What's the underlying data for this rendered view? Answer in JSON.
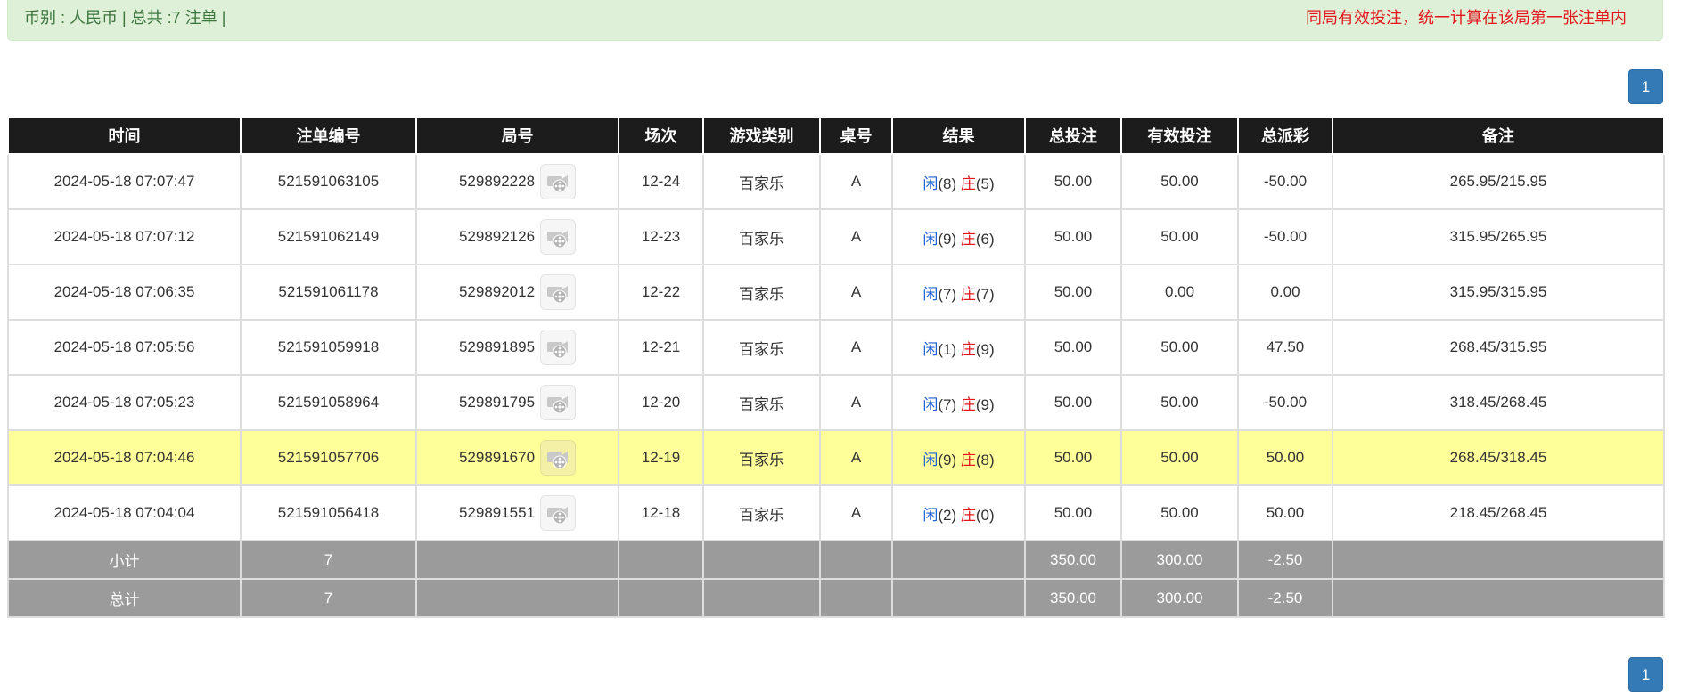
{
  "alert": {
    "currency_summary": "币别 : 人民币 | 总共 :7 注单 |",
    "notice": "同局有效投注，统一计算在该局第一张注单内"
  },
  "pagination": {
    "current_page": "1"
  },
  "colors": {
    "blue": "#1a62d6",
    "red": "#e4161c",
    "highlight": "#ffff99",
    "header": "#1c1c1c",
    "footer": "#9b9b9b"
  },
  "table": {
    "headers": [
      "时间",
      "注单编号",
      "局号",
      "场次",
      "游戏类别",
      "桌号",
      "结果",
      "总投注",
      "有效投注",
      "总派彩",
      "备注"
    ],
    "player_label": "闲",
    "banker_label": "庄",
    "icon": "video-replay-icon",
    "rows": [
      {
        "time": "2024-05-18 07:07:47",
        "bet_id": "521591063105",
        "round": "529892228",
        "session": "12-24",
        "game": "百家乐",
        "table_no": "A",
        "player_score": "(8)",
        "banker_score": "(5)",
        "total_bet": "50.00",
        "valid_bet": "50.00",
        "payout": "-50.00",
        "payout_negative": true,
        "note": "265.95/215.95",
        "highlight": false
      },
      {
        "time": "2024-05-18 07:07:12",
        "bet_id": "521591062149",
        "round": "529892126",
        "session": "12-23",
        "game": "百家乐",
        "table_no": "A",
        "player_score": "(9)",
        "banker_score": "(6)",
        "total_bet": "50.00",
        "valid_bet": "50.00",
        "payout": "-50.00",
        "payout_negative": true,
        "note": "315.95/265.95",
        "highlight": false
      },
      {
        "time": "2024-05-18 07:06:35",
        "bet_id": "521591061178",
        "round": "529892012",
        "session": "12-22",
        "game": "百家乐",
        "table_no": "A",
        "player_score": "(7)",
        "banker_score": "(7)",
        "total_bet": "50.00",
        "valid_bet": "0.00",
        "payout": "0.00",
        "payout_negative": false,
        "note": "315.95/315.95",
        "highlight": false
      },
      {
        "time": "2024-05-18 07:05:56",
        "bet_id": "521591059918",
        "round": "529891895",
        "session": "12-21",
        "game": "百家乐",
        "table_no": "A",
        "player_score": "(1)",
        "banker_score": "(9)",
        "total_bet": "50.00",
        "valid_bet": "50.00",
        "payout": "47.50",
        "payout_negative": false,
        "note": "268.45/315.95",
        "highlight": false
      },
      {
        "time": "2024-05-18 07:05:23",
        "bet_id": "521591058964",
        "round": "529891795",
        "session": "12-20",
        "game": "百家乐",
        "table_no": "A",
        "player_score": "(7)",
        "banker_score": "(9)",
        "total_bet": "50.00",
        "valid_bet": "50.00",
        "payout": "-50.00",
        "payout_negative": true,
        "note": "318.45/268.45",
        "highlight": false
      },
      {
        "time": "2024-05-18 07:04:46",
        "bet_id": "521591057706",
        "round": "529891670",
        "session": "12-19",
        "game": "百家乐",
        "table_no": "A",
        "player_score": "(9)",
        "banker_score": "(8)",
        "total_bet": "50.00",
        "valid_bet": "50.00",
        "payout": "50.00",
        "payout_negative": false,
        "note": "268.45/318.45",
        "highlight": true
      },
      {
        "time": "2024-05-18 07:04:04",
        "bet_id": "521591056418",
        "round": "529891551",
        "session": "12-18",
        "game": "百家乐",
        "table_no": "A",
        "player_score": "(2)",
        "banker_score": "(0)",
        "total_bet": "50.00",
        "valid_bet": "50.00",
        "payout": "50.00",
        "payout_negative": false,
        "note": "218.45/268.45",
        "highlight": false
      }
    ],
    "subtotal": {
      "label": "小计",
      "count": "7",
      "total_bet": "350.00",
      "valid_bet": "300.00",
      "payout": "-2.50"
    },
    "grand_total": {
      "label": "总计",
      "count": "7",
      "total_bet": "350.00",
      "valid_bet": "300.00",
      "payout": "-2.50"
    }
  }
}
